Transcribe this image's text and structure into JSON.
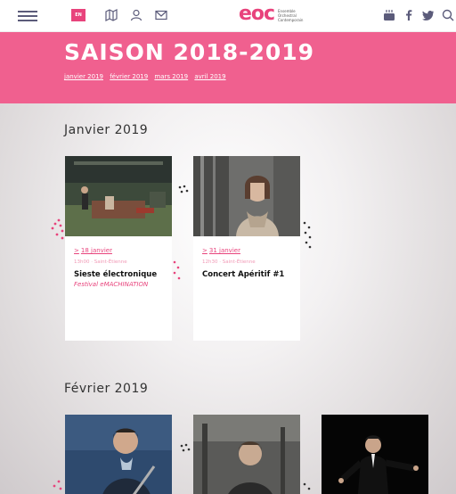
{
  "header": {
    "lang_label": "EN",
    "logo_text": "eoc",
    "logo_subtitle": "Ensemble Orchestral Contemporain"
  },
  "banner": {
    "title": "SAISON 2018-2019",
    "months": [
      "janvier 2019",
      "février 2019",
      "mars 2019",
      "avril 2019"
    ]
  },
  "sections": [
    {
      "title": "Janvier 2019",
      "events": [
        {
          "date": "18 janvier",
          "meta": "13h00 · Saint-Étienne",
          "title": "Sieste électronique",
          "subtitle": "Festival eMACHINATION"
        },
        {
          "date": "31 janvier",
          "meta": "12h30 · Saint-Étienne",
          "title": "Concert Apéritif #1",
          "subtitle": ""
        }
      ]
    },
    {
      "title": "Février 2019",
      "events": []
    }
  ],
  "colors": {
    "accent": "#e8437c",
    "banner": "#f0608f",
    "nav_icon": "#5b5b7a"
  },
  "icons": [
    "menu-icon",
    "map-icon",
    "user-icon",
    "mail-icon",
    "youtube-icon",
    "facebook-icon",
    "twitter-icon",
    "search-icon"
  ]
}
